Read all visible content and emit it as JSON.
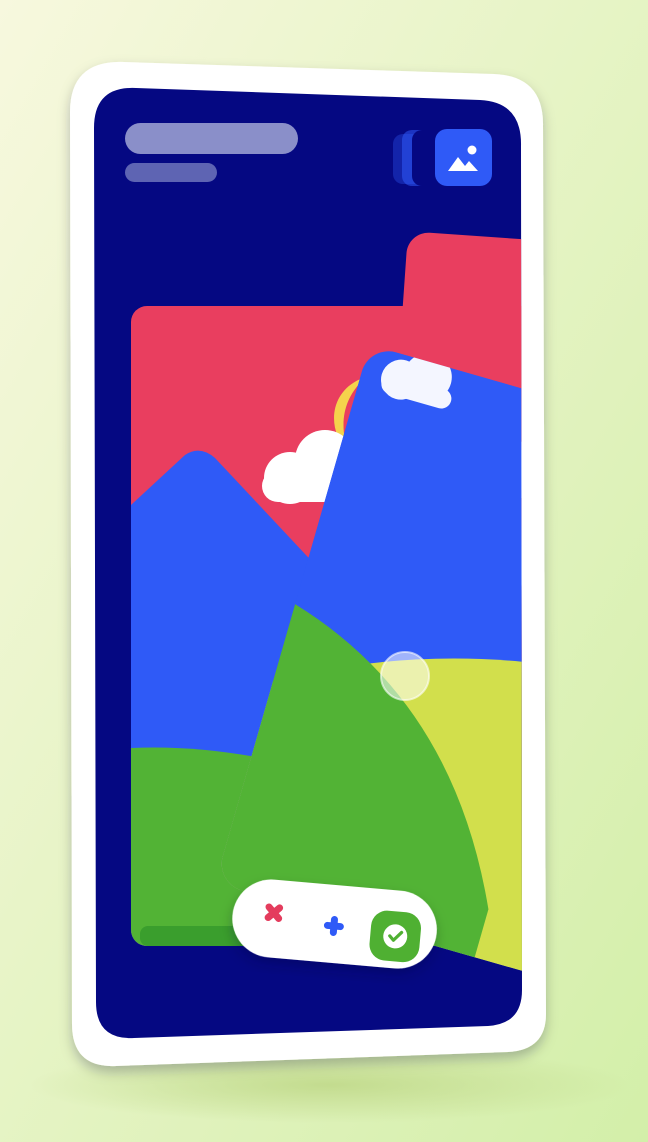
{
  "colors": {
    "background_top_left": "#f6f7dc",
    "background_bottom_right": "#d4efaa",
    "phone_frame": "#ffffff",
    "screen": "#050882",
    "header_bar": "#8a8fc9",
    "header_bar_secondary": "#5e64b3",
    "accent_blue": "#2f5af7",
    "mountain_blue": "#2f5af7",
    "sky_red": "#e93e5f",
    "moon_yellow": "#f5d34c",
    "cloud_white": "#ffffff",
    "hill_green": "#52b335",
    "hill_lime": "#d2df4c",
    "reject_red": "#e43c5d",
    "accept_green": "#4fb032"
  },
  "header": {
    "title_placeholder": "",
    "subtitle_placeholder": "",
    "gallery_icon": "image-gallery-icon"
  },
  "card_stack": {
    "cards": [
      {
        "id": "back",
        "scene": "red-sky-mountains-clouds"
      },
      {
        "id": "front",
        "scene": "blue-mountain-green-hills"
      }
    ],
    "drag_indicator": "drag-touch-indicator"
  },
  "action_bar": {
    "reject_icon": "x-icon",
    "add_icon": "plus-icon",
    "accept_icon": "check-icon"
  }
}
